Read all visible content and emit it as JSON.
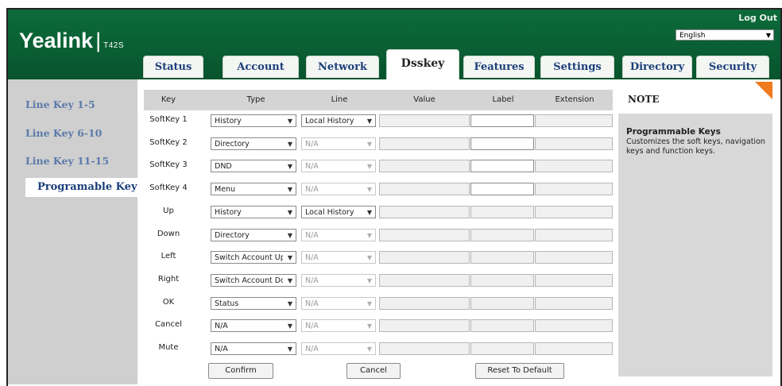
{
  "header": {
    "logo_brand": "Yealink",
    "logo_sep": "|",
    "logo_model": "T42S",
    "logout_label": "Log Out",
    "language_value": "English"
  },
  "tabs": [
    {
      "label": "Status"
    },
    {
      "label": "Account"
    },
    {
      "label": "Network"
    },
    {
      "label": "Dsskey"
    },
    {
      "label": "Features"
    },
    {
      "label": "Settings"
    },
    {
      "label": "Directory"
    },
    {
      "label": "Security"
    }
  ],
  "active_tab": "Dsskey",
  "sidebar": {
    "items": [
      {
        "label": "Line Key 1-5"
      },
      {
        "label": "Line Key 6-10"
      },
      {
        "label": "Line Key 11-15"
      },
      {
        "label": "Programable Key"
      }
    ],
    "active_index": 3
  },
  "table": {
    "headers": [
      "Key",
      "Type",
      "Line",
      "Value",
      "Label",
      "Extension"
    ],
    "rows": [
      {
        "key": "SoftKey 1",
        "type": "History",
        "line": "Local History",
        "line_enabled": true,
        "label_enabled": true
      },
      {
        "key": "SoftKey 2",
        "type": "Directory",
        "line": "N/A",
        "line_enabled": false,
        "label_enabled": true
      },
      {
        "key": "SoftKey 3",
        "type": "DND",
        "line": "N/A",
        "line_enabled": false,
        "label_enabled": true
      },
      {
        "key": "SoftKey 4",
        "type": "Menu",
        "line": "N/A",
        "line_enabled": false,
        "label_enabled": true
      },
      {
        "key": "Up",
        "type": "History",
        "line": "Local History",
        "line_enabled": true,
        "label_enabled": false
      },
      {
        "key": "Down",
        "type": "Directory",
        "line": "N/A",
        "line_enabled": false,
        "label_enabled": false
      },
      {
        "key": "Left",
        "type": "Switch Account Up",
        "line": "N/A",
        "line_enabled": false,
        "label_enabled": false
      },
      {
        "key": "Right",
        "type": "Switch Account Down",
        "line": "N/A",
        "line_enabled": false,
        "label_enabled": false
      },
      {
        "key": "OK",
        "type": "Status",
        "line": "N/A",
        "line_enabled": false,
        "label_enabled": false
      },
      {
        "key": "Cancel",
        "type": "N/A",
        "line": "N/A",
        "line_enabled": false,
        "label_enabled": false
      },
      {
        "key": "Mute",
        "type": "N/A",
        "line": "N/A",
        "line_enabled": false,
        "label_enabled": false
      }
    ]
  },
  "buttons": {
    "confirm": "Confirm",
    "cancel": "Cancel",
    "reset": "Reset To Default"
  },
  "note": {
    "title": "NOTE",
    "heading": "Programmable Keys",
    "text": "Customizes the soft keys, navigation keys and function keys."
  },
  "colors": {
    "header_green": "#0a5f33",
    "note_accent": "#f07a1e",
    "nav_link": "#5b7aa9"
  }
}
